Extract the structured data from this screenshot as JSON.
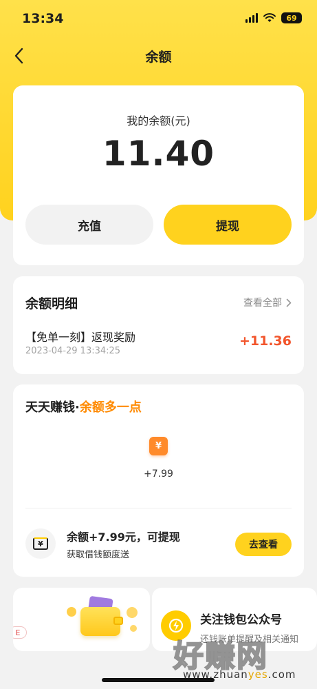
{
  "status_bar": {
    "time": "13:34",
    "battery": "69"
  },
  "nav": {
    "title": "余额"
  },
  "balance": {
    "label": "我的余额(元)",
    "amount": "11.40",
    "recharge_label": "充值",
    "withdraw_label": "提现"
  },
  "detail": {
    "title": "余额明细",
    "view_all": "查看全部",
    "items": [
      {
        "title": "【免单一刻】返现奖励",
        "time": "2023-04-29 13:34:25",
        "amount": "+11.36"
      }
    ]
  },
  "earn": {
    "title_main": "天天赚钱",
    "title_dot": "·",
    "title_accent": "余额多一点",
    "coin_symbol": "¥",
    "coin_value": "+7.99",
    "task_title": "余额+7.99元，可提现",
    "task_sub": "获取借钱额度送",
    "task_button": "去查看",
    "task_icon_symbol": "¥"
  },
  "banners": {
    "left_badge": "E",
    "right_title": "关注钱包公众号",
    "right_sub": "还钱账单提醒及相关通知"
  },
  "watermark": {
    "big": "好赚网",
    "small_a": "www.zhuan",
    "small_b": "yes",
    "small_c": ".com"
  },
  "colors": {
    "brand_yellow": "#ffd21e",
    "accent_orange": "#ff8a00",
    "amount_red": "#f2552c"
  }
}
